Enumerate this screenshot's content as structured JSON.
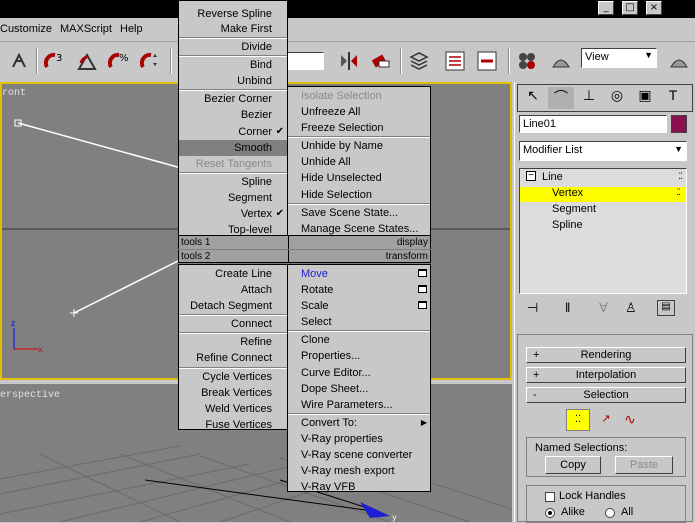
{
  "menubar": {
    "items": [
      "Customize",
      "MAXScript",
      "Help"
    ]
  },
  "toolbar": {
    "view_dropdown": "View"
  },
  "viewports": {
    "front_label": "ront",
    "persp_label": "erspective"
  },
  "command_panel": {
    "object_name": "Line01",
    "object_color": "#8a1050",
    "modifier_list": "Modifier List",
    "stack": {
      "root": "Line",
      "items": [
        "Vertex",
        "Segment",
        "Spline"
      ],
      "selected": "Vertex"
    },
    "rollouts": {
      "rendering": "Rendering",
      "interpolation": "Interpolation",
      "selection": "Selection"
    },
    "named_selections": {
      "label": "Named Selections:",
      "copy": "Copy",
      "paste": "Paste"
    },
    "lock_handles": "Lock Handles",
    "alike": "Alike",
    "all": "All"
  },
  "quad_tools1": {
    "header_left": "tools 1",
    "header_right": "display",
    "left_top": [
      "Reverse Spline",
      "Make First",
      "Divide",
      "Bind",
      "Unbind",
      "Bezier Corner",
      "Bezier",
      "Corner",
      "Smooth",
      "Reset Tangents",
      "Spline",
      "Segment",
      "Vertex",
      "Top-level"
    ],
    "right_top": [
      "Isolate Selection",
      "Unfreeze All",
      "Freeze Selection",
      "Unhide by Name",
      "Unhide All",
      "Hide Unselected",
      "Hide Selection",
      "Save Scene State...",
      "Manage Scene States..."
    ]
  },
  "quad_tools2": {
    "header_left": "tools 2",
    "header_right": "transform",
    "left_bottom": [
      "Create Line",
      "Attach",
      "Detach Segment",
      "Connect",
      "Refine",
      "Refine Connect",
      "Cycle Vertices",
      "Break Vertices",
      "Weld Vertices",
      "Fuse Vertices"
    ],
    "right_bottom": [
      "Move",
      "Rotate",
      "Scale",
      "Select",
      "Clone",
      "Properties...",
      "Curve Editor...",
      "Dope Sheet...",
      "Wire Parameters...",
      "Convert To:",
      "V-Ray properties",
      "V-Ray scene converter",
      "V-Ray mesh export",
      "V-Ray VFB"
    ]
  },
  "colors": {
    "selection_yellow": "#ffff00",
    "viewport_gray": "#808080",
    "active_border": "#e0c000",
    "highlight_blue": "#1e1ed2"
  }
}
